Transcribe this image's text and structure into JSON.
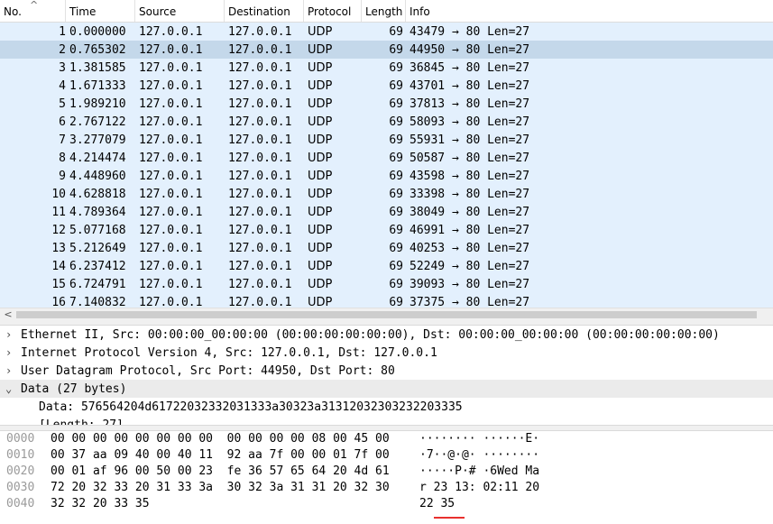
{
  "packet_list": {
    "columns": [
      "No.",
      "Time",
      "Source",
      "Destination",
      "Protocol",
      "Length",
      "Info"
    ],
    "sort_icon": "^",
    "rows": [
      {
        "no": "1",
        "time": "0.000000",
        "src": "127.0.0.1",
        "dst": "127.0.0.1",
        "proto": "UDP",
        "len": "69",
        "info": "43479 → 80 Len=27"
      },
      {
        "no": "2",
        "time": "0.765302",
        "src": "127.0.0.1",
        "dst": "127.0.0.1",
        "proto": "UDP",
        "len": "69",
        "info": "44950 → 80 Len=27",
        "selected": true
      },
      {
        "no": "3",
        "time": "1.381585",
        "src": "127.0.0.1",
        "dst": "127.0.0.1",
        "proto": "UDP",
        "len": "69",
        "info": "36845 → 80 Len=27"
      },
      {
        "no": "4",
        "time": "1.671333",
        "src": "127.0.0.1",
        "dst": "127.0.0.1",
        "proto": "UDP",
        "len": "69",
        "info": "43701 → 80 Len=27"
      },
      {
        "no": "5",
        "time": "1.989210",
        "src": "127.0.0.1",
        "dst": "127.0.0.1",
        "proto": "UDP",
        "len": "69",
        "info": "37813 → 80 Len=27"
      },
      {
        "no": "6",
        "time": "2.767122",
        "src": "127.0.0.1",
        "dst": "127.0.0.1",
        "proto": "UDP",
        "len": "69",
        "info": "58093 → 80 Len=27"
      },
      {
        "no": "7",
        "time": "3.277079",
        "src": "127.0.0.1",
        "dst": "127.0.0.1",
        "proto": "UDP",
        "len": "69",
        "info": "55931 → 80 Len=27"
      },
      {
        "no": "8",
        "time": "4.214474",
        "src": "127.0.0.1",
        "dst": "127.0.0.1",
        "proto": "UDP",
        "len": "69",
        "info": "50587 → 80 Len=27"
      },
      {
        "no": "9",
        "time": "4.448960",
        "src": "127.0.0.1",
        "dst": "127.0.0.1",
        "proto": "UDP",
        "len": "69",
        "info": "43598 → 80 Len=27"
      },
      {
        "no": "10",
        "time": "4.628818",
        "src": "127.0.0.1",
        "dst": "127.0.0.1",
        "proto": "UDP",
        "len": "69",
        "info": "33398 → 80 Len=27"
      },
      {
        "no": "11",
        "time": "4.789364",
        "src": "127.0.0.1",
        "dst": "127.0.0.1",
        "proto": "UDP",
        "len": "69",
        "info": "38049 → 80 Len=27"
      },
      {
        "no": "12",
        "time": "5.077168",
        "src": "127.0.0.1",
        "dst": "127.0.0.1",
        "proto": "UDP",
        "len": "69",
        "info": "46991 → 80 Len=27"
      },
      {
        "no": "13",
        "time": "5.212649",
        "src": "127.0.0.1",
        "dst": "127.0.0.1",
        "proto": "UDP",
        "len": "69",
        "info": "40253 → 80 Len=27"
      },
      {
        "no": "14",
        "time": "6.237412",
        "src": "127.0.0.1",
        "dst": "127.0.0.1",
        "proto": "UDP",
        "len": "69",
        "info": "52249 → 80 Len=27"
      },
      {
        "no": "15",
        "time": "6.724791",
        "src": "127.0.0.1",
        "dst": "127.0.0.1",
        "proto": "UDP",
        "len": "69",
        "info": "39093 → 80 Len=27"
      },
      {
        "no": "16",
        "time": "7.140832",
        "src": "127.0.0.1",
        "dst": "127.0.0.1",
        "proto": "UDP",
        "len": "69",
        "info": "37375 → 80 Len=27"
      }
    ]
  },
  "scrollbar": {
    "left_arrow": "<"
  },
  "details": {
    "rows": [
      {
        "chevron": "›",
        "text": "Ethernet II, Src: 00:00:00_00:00:00 (00:00:00:00:00:00), Dst: 00:00:00_00:00:00 (00:00:00:00:00:00)",
        "style": "plain"
      },
      {
        "chevron": "›",
        "text": "Internet Protocol Version 4, Src: 127.0.0.1, Dst: 127.0.0.1",
        "style": "plain"
      },
      {
        "chevron": "›",
        "text": "User Datagram Protocol, Src Port: 44950, Dst Port: 80",
        "style": "plain"
      },
      {
        "chevron": "⌄",
        "text": "Data (27 bytes)",
        "style": "gray"
      },
      {
        "chevron": "",
        "text": "Data: 576564204d61722032332031333a30323a31312032303232203335",
        "style": "child"
      },
      {
        "chevron": "",
        "text": "[Length: 27]",
        "style": "child"
      }
    ]
  },
  "bytes": {
    "rows": [
      {
        "offset": "0000",
        "hex": "00 00 00 00 00 00 00 00  00 00 00 00 08 00 45 00",
        "ascii": "········ ······E·"
      },
      {
        "offset": "0010",
        "hex": "00 37 aa 09 40 00 40 11  92 aa 7f 00 00 01 7f 00",
        "ascii": "·7··@·@· ········"
      },
      {
        "offset": "0020",
        "hex": "00 01 af 96 00 50 00 23  fe 36 57 65 64 20 4d 61",
        "ascii": "·····P·# ·6Wed Ma"
      },
      {
        "offset": "0030",
        "hex": "72 20 32 33 20 31 33 3a  30 32 3a 31 31 20 32 30",
        "ascii": "r 23 13: 02:11 20"
      },
      {
        "offset": "0040",
        "hex": "32 32 20 33 35",
        "ascii": "22 35"
      }
    ],
    "highlight_color": "#e8302e"
  },
  "colors": {
    "row_bg": "#e3f0fd",
    "selected_row_bg": "#c4d8ea",
    "offset_text": "#9a9a9a"
  }
}
